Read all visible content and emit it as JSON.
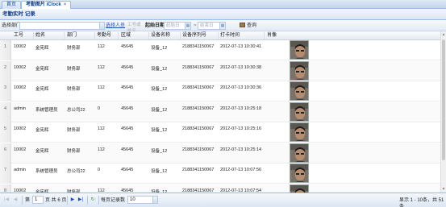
{
  "tabs": [
    {
      "label": "首页"
    },
    {
      "label": "考勤图片 iClock",
      "close": "×"
    }
  ],
  "panel": {
    "title": "考勤实时 记录"
  },
  "toolbar": {
    "dept_label": "选择部门",
    "dept_value": "",
    "person_link": "选择人员",
    "person_placeholder": "工号或姓名",
    "date_label": "起始日期",
    "start_placeholder": "起始日",
    "end_placeholder": "结束日",
    "query_label": "查询"
  },
  "grid": {
    "columns": [
      "工号",
      "姓名",
      "部门",
      "考勤号",
      "区域",
      "设备名称",
      "设备序列号",
      "打卡时间",
      "肖像"
    ],
    "rows": [
      {
        "n": "1",
        "id": "10002",
        "name": "金宪辉",
        "dept": "财务部",
        "att": "112",
        "area": "45645",
        "device": "设备_12",
        "serial": "2188341150067",
        "time": "2012-07-13 10:30:41"
      },
      {
        "n": "2",
        "id": "10002",
        "name": "金宪辉",
        "dept": "财务部",
        "att": "112",
        "area": "45645",
        "device": "设备_12",
        "serial": "2188341150067",
        "time": "2012-07-13 10:30:38"
      },
      {
        "n": "3",
        "id": "10002",
        "name": "金宪辉",
        "dept": "财务部",
        "att": "112",
        "area": "45645",
        "device": "设备_12",
        "serial": "2188341150067",
        "time": "2012-07-13 10:30:36"
      },
      {
        "n": "4",
        "id": "admin",
        "name": "系统管理员",
        "dept": "总公司22",
        "att": "0",
        "area": "45645",
        "device": "设备_12",
        "serial": "2188341150067",
        "time": "2012-07-13 10:25:18"
      },
      {
        "n": "5",
        "id": "10002",
        "name": "金宪辉",
        "dept": "财务部",
        "att": "112",
        "area": "45645",
        "device": "设备_12",
        "serial": "2188341150067",
        "time": "2012-07-13 10:25:16"
      },
      {
        "n": "6",
        "id": "10002",
        "name": "金宪辉",
        "dept": "财务部",
        "att": "112",
        "area": "45645",
        "device": "设备_12",
        "serial": "2188341150067",
        "time": "2012-07-13 10:25:14"
      },
      {
        "n": "7",
        "id": "admin",
        "name": "系统管理员",
        "dept": "总公司22",
        "att": "0",
        "area": "45645",
        "device": "设备_12",
        "serial": "2188341150067",
        "time": "2012-07-13 10:07:56"
      },
      {
        "n": "8",
        "id": "10002",
        "name": "金宪辉",
        "dept": "财务部",
        "att": "112",
        "area": "45645",
        "device": "设备_12",
        "serial": "2188341150067",
        "time": "2012-07-13 10:07:54"
      }
    ]
  },
  "pager": {
    "page_label": "第",
    "page_value": "1",
    "of_label": "页 共 6 页",
    "size_label": "每页记录数",
    "size_value": "10",
    "status": "显示 1 - 10条，共 51 条"
  },
  "icons": {
    "first": "first-page-icon",
    "prev": "prev-page-icon",
    "next": "next-page-icon",
    "last": "last-page-icon",
    "refresh": "refresh-icon",
    "calendar": "calendar-icon",
    "search": "search-icon"
  },
  "colors": {
    "header_text": "#15428b",
    "link": "#1d4fb3",
    "border": "#99bbe8"
  }
}
